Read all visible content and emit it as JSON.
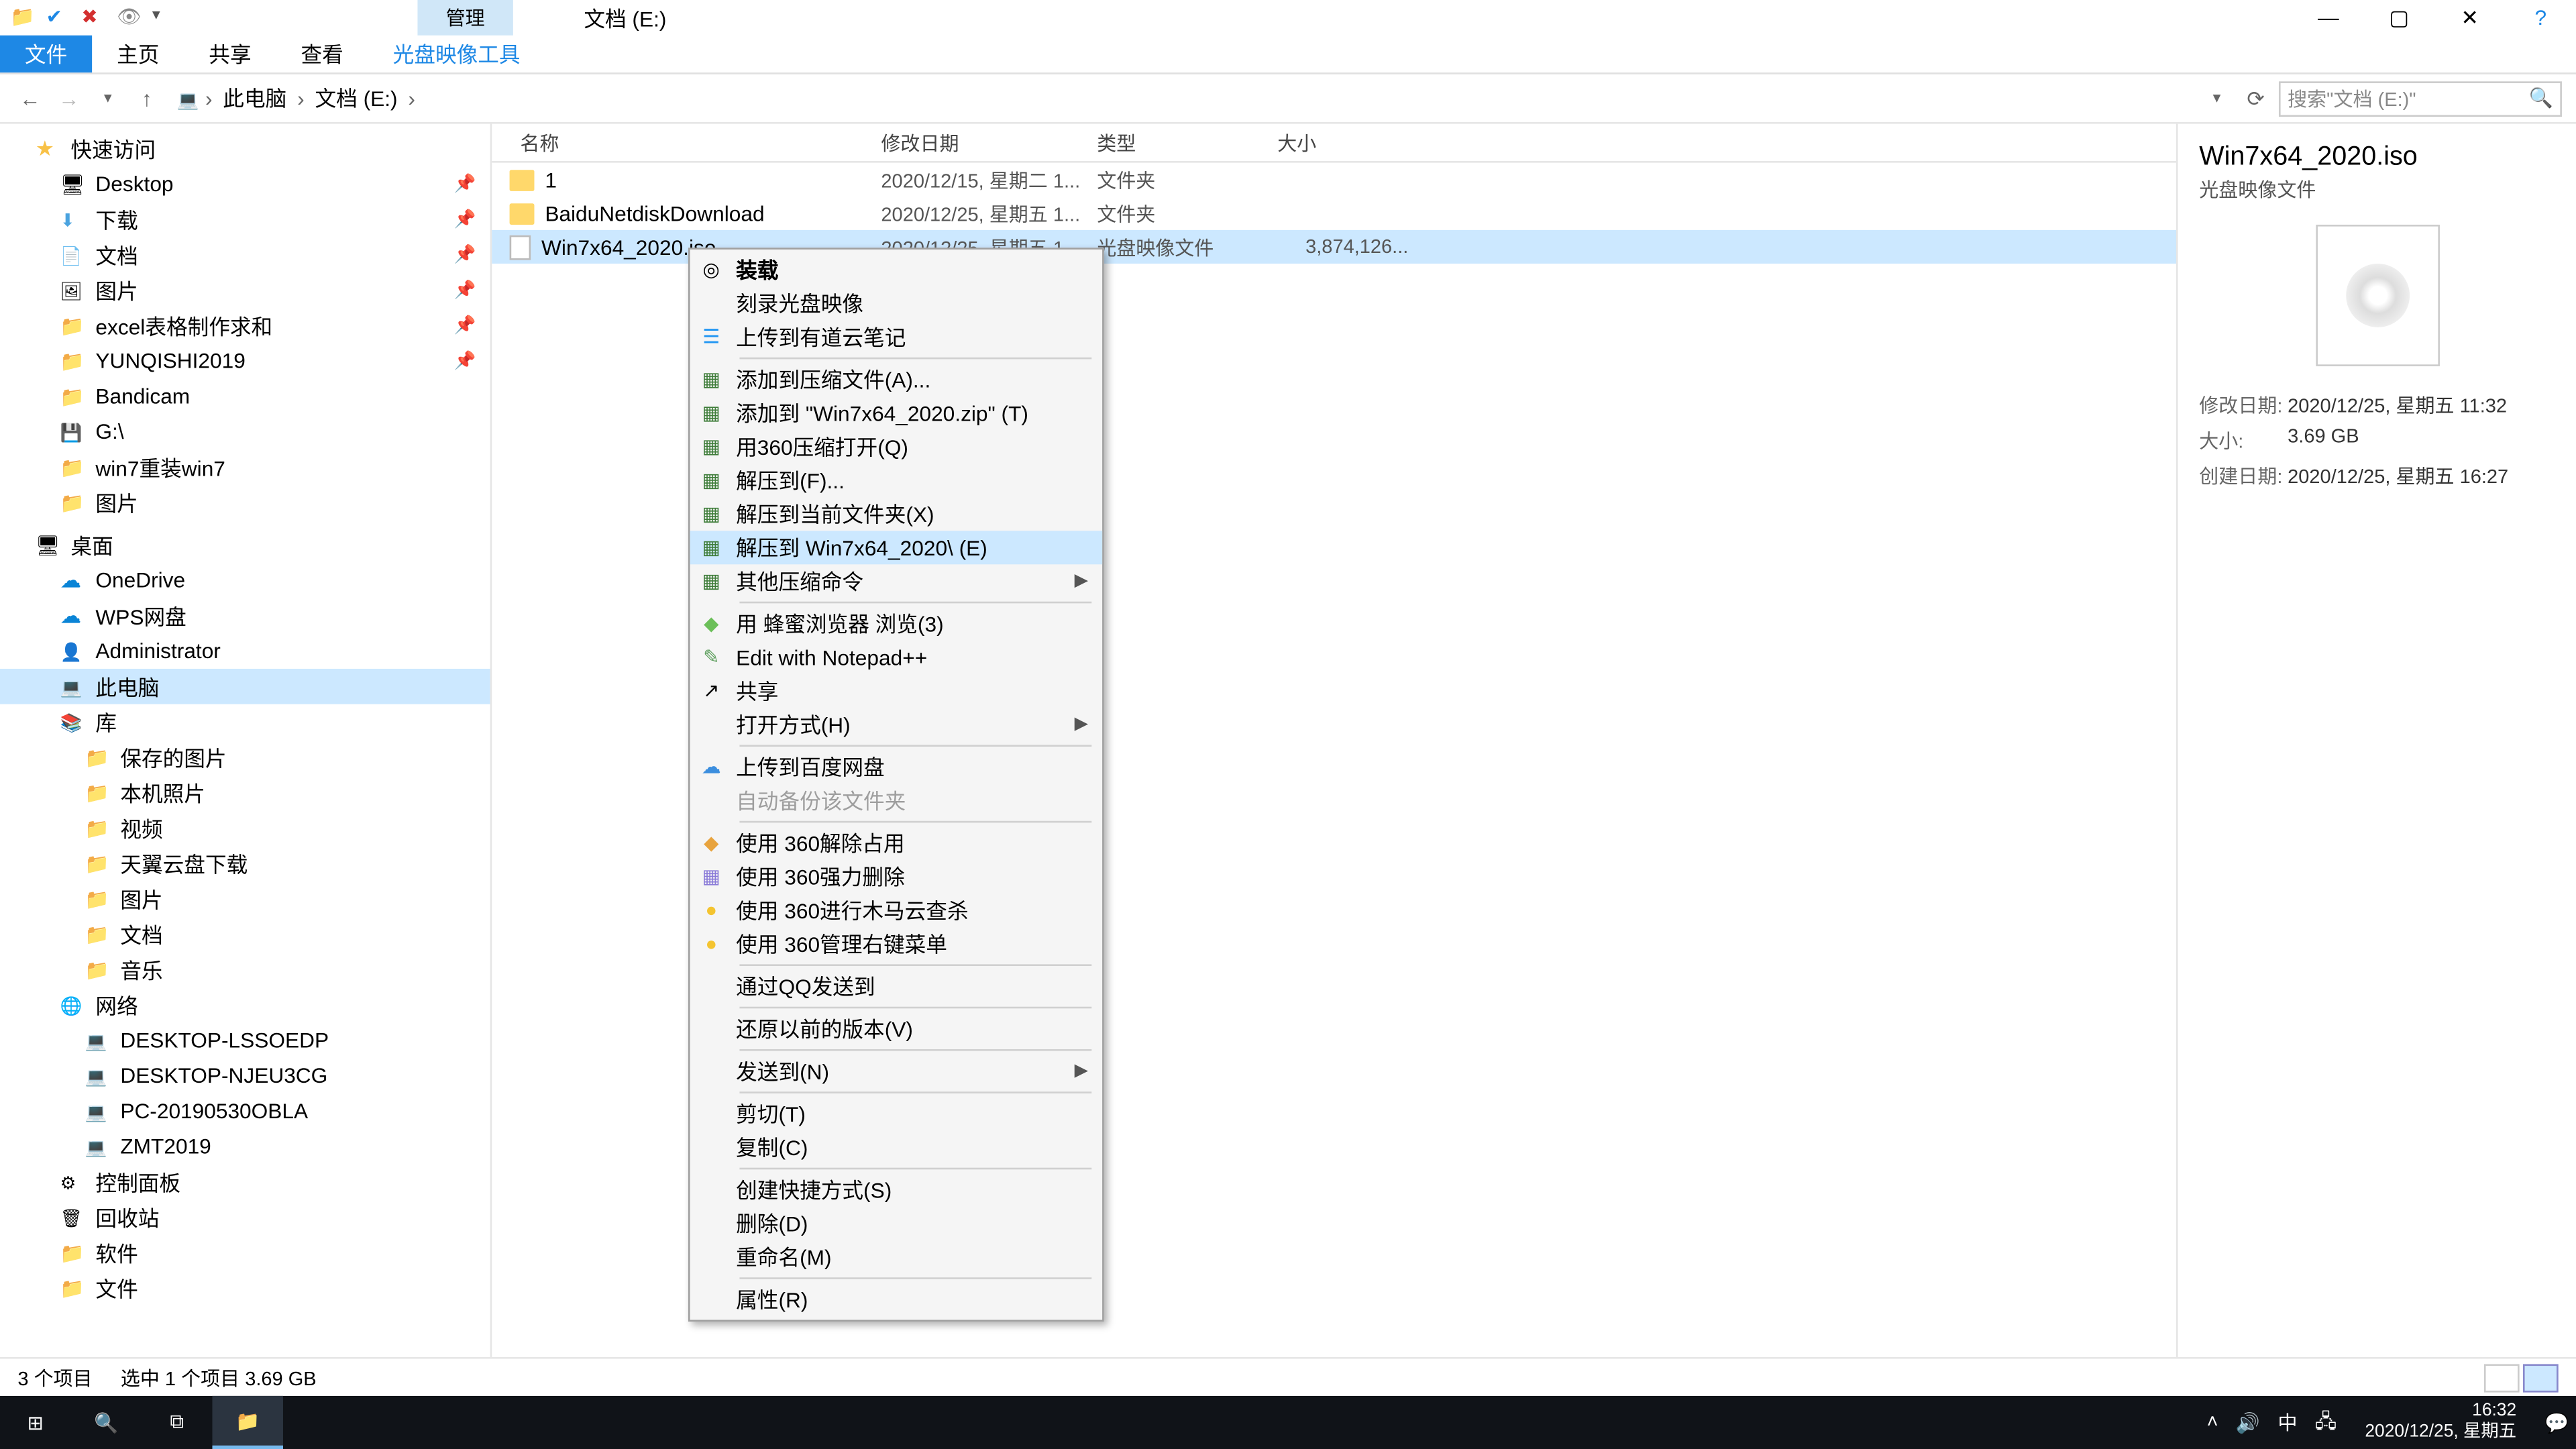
{
  "window": {
    "contextual_tab": "管理",
    "title": "文档 (E:)",
    "min": "—",
    "max": "▢",
    "close": "✕"
  },
  "ribbon": {
    "file": "文件",
    "home": "主页",
    "share": "共享",
    "view": "查看",
    "tool": "光盘映像工具"
  },
  "breadcrumb": {
    "root": "此电脑",
    "drive": "文档 (E:)",
    "search_placeholder": "搜索\"文档 (E:)\""
  },
  "columns": {
    "name": "名称",
    "date": "修改日期",
    "type": "类型",
    "size": "大小"
  },
  "files": [
    {
      "name": "1",
      "date": "2020/12/15, 星期二 1...",
      "type": "文件夹",
      "size": "",
      "kind": "folder"
    },
    {
      "name": "BaiduNetdiskDownload",
      "date": "2020/12/25, 星期五 1...",
      "type": "文件夹",
      "size": "",
      "kind": "folder"
    },
    {
      "name": "Win7x64_2020.iso",
      "date": "2020/12/25, 星期五 1...",
      "type": "光盘映像文件",
      "size": "3,874,126...",
      "kind": "file",
      "selected": true
    }
  ],
  "nav": {
    "quick": "快速访问",
    "desktop": "Desktop",
    "downloads": "下载",
    "docs": "文档",
    "pics": "图片",
    "excel": "excel表格制作求和",
    "yunqishi": "YUNQISHI2019",
    "bandicam": "Bandicam",
    "gdrive": "G:\\",
    "win7": "win7重装win7",
    "pics2": "图片",
    "deskgrp": "桌面",
    "onedrive": "OneDrive",
    "wps": "WPS网盘",
    "admin": "Administrator",
    "thispc": "此电脑",
    "lib": "库",
    "saved": "保存的图片",
    "localcam": "本机照片",
    "video": "视频",
    "tianyi": "天翼云盘下载",
    "pics3": "图片",
    "doc2": "文档",
    "music": "音乐",
    "network": "网络",
    "pc1": "DESKTOP-LSSOEDP",
    "pc2": "DESKTOP-NJEU3CG",
    "pc3": "PC-20190530OBLA",
    "pc4": "ZMT2019",
    "ctrl": "控制面板",
    "bin": "回收站",
    "soft": "软件",
    "file2": "文件"
  },
  "context_menu": [
    {
      "label": "装载",
      "bold": true,
      "icon": "◎"
    },
    {
      "label": "刻录光盘映像"
    },
    {
      "label": "上传到有道云笔记",
      "icon": "☰",
      "icon_color": "#2196f3"
    },
    {
      "sep": true
    },
    {
      "label": "添加到压缩文件(A)...",
      "icon": "▦",
      "icon_color": "#3f7d3a"
    },
    {
      "label": "添加到 \"Win7x64_2020.zip\" (T)",
      "icon": "▦",
      "icon_color": "#3f7d3a"
    },
    {
      "label": "用360压缩打开(Q)",
      "icon": "▦",
      "icon_color": "#3f7d3a"
    },
    {
      "label": "解压到(F)...",
      "icon": "▦",
      "icon_color": "#3f7d3a"
    },
    {
      "label": "解压到当前文件夹(X)",
      "icon": "▦",
      "icon_color": "#3f7d3a"
    },
    {
      "label": "解压到 Win7x64_2020\\ (E)",
      "icon": "▦",
      "icon_color": "#3f7d3a",
      "hover": true
    },
    {
      "label": "其他压缩命令",
      "icon": "▦",
      "icon_color": "#3f7d3a",
      "submenu": true
    },
    {
      "sep": true
    },
    {
      "label": "用 蜂蜜浏览器 浏览(3)",
      "icon": "◆",
      "icon_color": "#6bbf59"
    },
    {
      "label": "Edit with Notepad++",
      "icon": "✎",
      "icon_color": "#5c9e5c"
    },
    {
      "label": "共享",
      "icon": "↗"
    },
    {
      "label": "打开方式(H)",
      "submenu": true
    },
    {
      "sep": true
    },
    {
      "label": "上传到百度网盘",
      "icon": "☁",
      "icon_color": "#3b8ede"
    },
    {
      "label": "自动备份该文件夹",
      "disabled": true
    },
    {
      "sep": true
    },
    {
      "label": "使用 360解除占用",
      "icon": "◆",
      "icon_color": "#e8a33d"
    },
    {
      "label": "使用 360强力删除",
      "icon": "▦",
      "icon_color": "#8a7bd8"
    },
    {
      "label": "使用 360进行木马云查杀",
      "icon": "●",
      "icon_color": "#f4c430"
    },
    {
      "label": "使用 360管理右键菜单",
      "icon": "●",
      "icon_color": "#f4c430"
    },
    {
      "sep": true
    },
    {
      "label": "通过QQ发送到"
    },
    {
      "sep": true
    },
    {
      "label": "还原以前的版本(V)"
    },
    {
      "sep": true
    },
    {
      "label": "发送到(N)",
      "submenu": true
    },
    {
      "sep": true
    },
    {
      "label": "剪切(T)"
    },
    {
      "label": "复制(C)"
    },
    {
      "sep": true
    },
    {
      "label": "创建快捷方式(S)"
    },
    {
      "label": "删除(D)"
    },
    {
      "label": "重命名(M)"
    },
    {
      "sep": true
    },
    {
      "label": "属性(R)"
    }
  ],
  "details": {
    "title": "Win7x64_2020.iso",
    "subtitle": "光盘映像文件",
    "mod_label": "修改日期:",
    "mod_val": "2020/12/25, 星期五 11:32",
    "size_label": "大小:",
    "size_val": "3.69 GB",
    "create_label": "创建日期:",
    "create_val": "2020/12/25, 星期五 16:27"
  },
  "status": {
    "count": "3 个项目",
    "selection": "选中 1 个项目  3.69 GB"
  },
  "taskbar": {
    "time": "16:32",
    "date": "2020/12/25, 星期五"
  }
}
